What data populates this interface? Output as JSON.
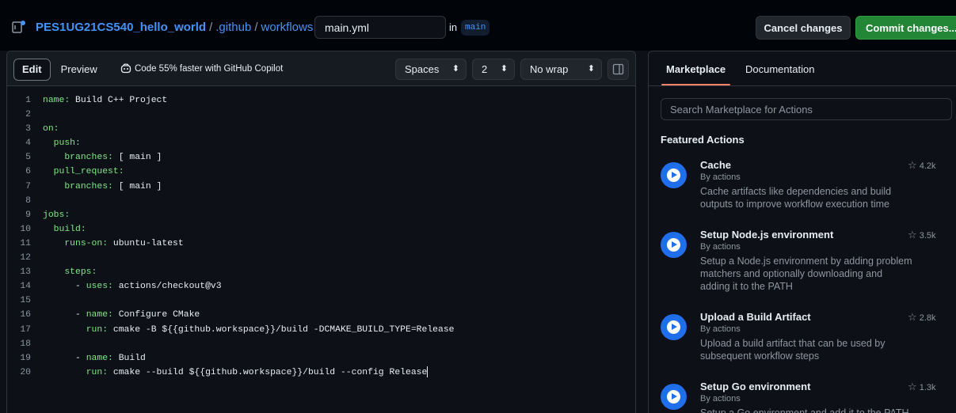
{
  "header": {
    "repo": "PES1UG21CS540_hello_world",
    "path": [
      ".github",
      "workflows"
    ],
    "filename": "main.yml",
    "in_label": "in",
    "branch": "main",
    "cancel_label": "Cancel changes",
    "commit_label": "Commit changes..."
  },
  "editor": {
    "tabs": {
      "edit": "Edit",
      "preview": "Preview"
    },
    "copilot_text": "Code 55% faster with GitHub Copilot",
    "indent_mode": "Spaces",
    "indent_size": "2",
    "wrap_mode": "No wrap",
    "lines": [
      {
        "n": "1",
        "indent": "",
        "key": "name:",
        "val": " Build C++ Project"
      },
      {
        "n": "2",
        "indent": "",
        "key": "",
        "val": ""
      },
      {
        "n": "3",
        "indent": "",
        "key": "on:",
        "val": ""
      },
      {
        "n": "4",
        "indent": "  ",
        "key": "push:",
        "val": ""
      },
      {
        "n": "5",
        "indent": "    ",
        "key": "branches:",
        "val": " [ main ]"
      },
      {
        "n": "6",
        "indent": "  ",
        "key": "pull_request:",
        "val": ""
      },
      {
        "n": "7",
        "indent": "    ",
        "key": "branches:",
        "val": " [ main ]"
      },
      {
        "n": "8",
        "indent": "",
        "key": "",
        "val": ""
      },
      {
        "n": "9",
        "indent": "",
        "key": "jobs:",
        "val": ""
      },
      {
        "n": "10",
        "indent": "  ",
        "key": "build:",
        "val": ""
      },
      {
        "n": "11",
        "indent": "    ",
        "key": "runs-on:",
        "val": " ubuntu-latest"
      },
      {
        "n": "12",
        "indent": "",
        "key": "",
        "val": ""
      },
      {
        "n": "13",
        "indent": "    ",
        "key": "steps:",
        "val": ""
      },
      {
        "n": "14",
        "indent": "      - ",
        "key": "uses:",
        "val": " actions/checkout@v3"
      },
      {
        "n": "15",
        "indent": "",
        "key": "",
        "val": ""
      },
      {
        "n": "16",
        "indent": "      - ",
        "key": "name:",
        "val": " Configure CMake"
      },
      {
        "n": "17",
        "indent": "        ",
        "key": "run:",
        "val": " cmake -B ${{github.workspace}}/build -DCMAKE_BUILD_TYPE=Release"
      },
      {
        "n": "18",
        "indent": "",
        "key": "",
        "val": ""
      },
      {
        "n": "19",
        "indent": "      - ",
        "key": "name:",
        "val": " Build"
      },
      {
        "n": "20",
        "indent": "        ",
        "key": "run:",
        "val": " cmake --build ${{github.workspace}}/build --config Release"
      }
    ]
  },
  "marketplace": {
    "tabs": {
      "marketplace": "Marketplace",
      "documentation": "Documentation"
    },
    "search_placeholder": "Search Marketplace for Actions",
    "featured_title": "Featured Actions",
    "actions": [
      {
        "name": "Cache",
        "by": "By actions",
        "desc": "Cache artifacts like dependencies and build outputs to improve workflow execution time",
        "stars": "4.2k"
      },
      {
        "name": "Setup Node.js environment",
        "by": "By actions",
        "desc": "Setup a Node.js environment by adding problem matchers and optionally downloading and adding it to the PATH",
        "stars": "3.5k"
      },
      {
        "name": "Upload a Build Artifact",
        "by": "By actions",
        "desc": "Upload a build artifact that can be used by subsequent workflow steps",
        "stars": "2.8k"
      },
      {
        "name": "Setup Go environment",
        "by": "By actions",
        "desc": "Setup a Go environment and add it to the PATH",
        "stars": "1.3k"
      }
    ]
  },
  "colors": {
    "accent_link": "#4493f8",
    "commit_green": "#238636",
    "yaml_key": "#7ee787",
    "tab_underline": "#f78166"
  }
}
